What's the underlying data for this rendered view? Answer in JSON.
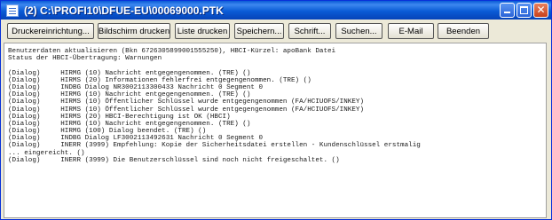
{
  "window": {
    "title": "(2) C:\\PROFI10\\DFUE-EU\\00069000.PTK"
  },
  "toolbar": {
    "buttons": [
      "Druckereinrichtung...",
      "Bildschirm drucken",
      "Liste drucken",
      "Speichern...",
      "Schrift...",
      "Suchen...",
      "E-Mail",
      "Beenden"
    ]
  },
  "log": {
    "lines": [
      "Benutzerdaten aktualisieren (Bkn 6726305899001555250), HBCI-Kürzel: apoBank Datei",
      "Status der HBCI-Übertragung: Warnungen",
      "",
      "(Dialog)     HIRMG (10) Nachricht entgegengenommen. (TRE) ()",
      "(Dialog)     HIRMS (20) Informationen fehlerfrei entgegengenommen. (TRE) ()",
      "(Dialog)     INDBG Dialog NR3002113300433 Nachricht 0 Segment 0",
      "(Dialog)     HIRMG (10) Nachricht entgegengenommen. (TRE) ()",
      "(Dialog)     HIRMS (10) Öffentlicher Schlüssel wurde entgegengenommen (FA/HCIUOFS/INKEY)",
      "(Dialog)     HIRMS (10) Öffentlicher Schlüssel wurde entgegengenommen (FA/HCIUOFS/INKEY)",
      "(Dialog)     HIRMS (20) HBCI-Berechtigung ist OK (HBCI)",
      "(Dialog)     HIRMG (10) Nachricht entgegengenommen. (TRE) ()",
      "(Dialog)     HIRMG (100) Dialog beendet. (TRE) ()",
      "(Dialog)     INDBG Dialog LF3002113492631 Nachricht 0 Segment 0",
      "(Dialog)     INERR (3999) Empfehlung: Kopie der Sicherheitsdatei erstellen - Kundenschlüssel erstmalig",
      "... eingereicht. ()",
      "(Dialog)     INERR (3999) Die Benutzerschlüssel sind noch nicht freigeschaltet. ()"
    ]
  }
}
